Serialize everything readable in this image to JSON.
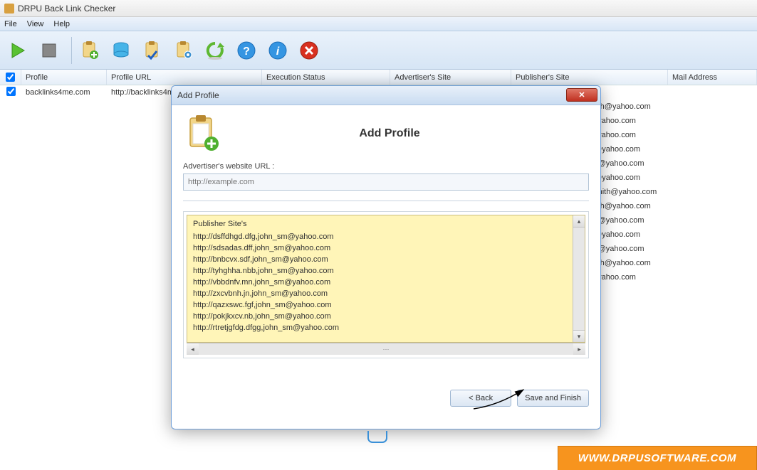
{
  "window": {
    "title": "DRPU Back Link Checker"
  },
  "menu": {
    "file": "File",
    "view": "View",
    "help": "Help"
  },
  "toolbar_icons": [
    "play-icon",
    "stop-icon",
    "clipboard-add-icon",
    "database-icon",
    "clipboard-check-icon",
    "clipboard-gear-icon",
    "refresh-icon",
    "help-icon",
    "info-icon",
    "cancel-icon"
  ],
  "grid": {
    "headers": {
      "profile": "Profile",
      "profile_url": "Profile URL",
      "exec_status": "Execution Status",
      "adv_site": "Advertiser's Site",
      "pub_site": "Publisher's Site",
      "mail": "Mail Address"
    },
    "row": {
      "profile": "backlinks4me.com",
      "profile_url": "http://backlinks4m"
    }
  },
  "mails": [
    "mith@yahoo.com",
    "@yahoo.com",
    "@yahoo.com",
    "n@yahoo.com",
    "ith@yahoo.com",
    "n@yahoo.com",
    ".smith@yahoo.com",
    "mith@yahoo.com",
    "ith@yahoo.com",
    "n@yahoo.com",
    "ith@yahoo.com",
    "mith@yahoo.com",
    "@yahoo.com"
  ],
  "modal": {
    "titlebar": "Add Profile",
    "heading": "Add Profile",
    "url_label": "Advertiser's website URL :",
    "url_placeholder": "http://example.com",
    "list_header": "Publisher Site's",
    "list_items": [
      "http://dsffdhgd.dfg,john_sm@yahoo.com",
      "http://sdsadas.dff,john_sm@yahoo.com",
      "http://bnbcvx.sdf,john_sm@yahoo.com",
      "http://tyhghha.nbb,john_sm@yahoo.com",
      "http://vbbdnfv.mn,john_sm@yahoo.com",
      "http://zxcvbnh.jn,john_sm@yahoo.com",
      "http://qazxswc.fgf,john_sm@yahoo.com",
      "http://pokjkxcv.nb,john_sm@yahoo.com",
      "http://rtretjgfdg.dfgg,john_sm@yahoo.com"
    ],
    "back": "< Back",
    "save": "Save and Finish"
  },
  "footer": {
    "url": "WWW.DRPUSOFTWARE.COM"
  }
}
